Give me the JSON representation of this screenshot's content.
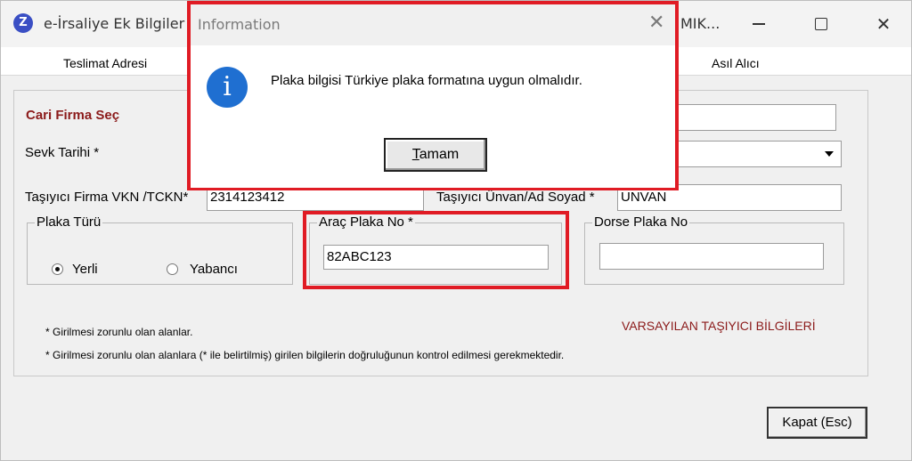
{
  "window": {
    "title": "e-İrsaliye Ek Bilgiler",
    "title_tail": "MIK...",
    "app_icon_glyph": "Z",
    "minimize_icon": "minimize-icon",
    "maximize_icon": "maximize-icon",
    "close_glyph": "✕"
  },
  "tabs": {
    "left": "Teslimat Adresi",
    "right": "Asıl Alıcı"
  },
  "form": {
    "cari_firma": "Cari Firma Seç",
    "sevk_tarihi_label": "Sevk Tarihi *",
    "vkn_label": "Taşıyıcı Firma VKN /TCKN*",
    "vkn_value": "2314123412",
    "unvan_label": "Taşıyıcı Ünvan/Ad Soyad *",
    "unvan_value": "UNVAN",
    "plaka_turu": {
      "title": "Plaka Türü",
      "options": [
        "Yerli",
        "Yabancı"
      ],
      "selected": "Yerli"
    },
    "arac_plaka": {
      "title": "Araç Plaka No *",
      "value": "82ABC123"
    },
    "dorse_plaka": {
      "title": "Dorse Plaka No",
      "value": ""
    },
    "note1": "* Girilmesi zorunlu olan alanlar.",
    "note2": "* Girilmesi zorunlu olan alanlara (* ile belirtilmiş) girilen bilgilerin doğruluğunun kontrol edilmesi gerekmektedir.",
    "varsayilan": "VARSAYILAN TAŞIYICI BİLGİLERİ",
    "kapat_button": "Kapat (Esc)"
  },
  "dialog": {
    "title": "Information",
    "close_glyph": "✕",
    "icon_glyph": "i",
    "message": "Plaka bilgisi Türkiye plaka formatına uygun olmalıdır.",
    "ok_accel": "T",
    "ok_rest": "amam"
  },
  "colors": {
    "highlight": "#e01b24",
    "accent_red": "#8b1a1a",
    "info_blue": "#1f6fd1"
  }
}
